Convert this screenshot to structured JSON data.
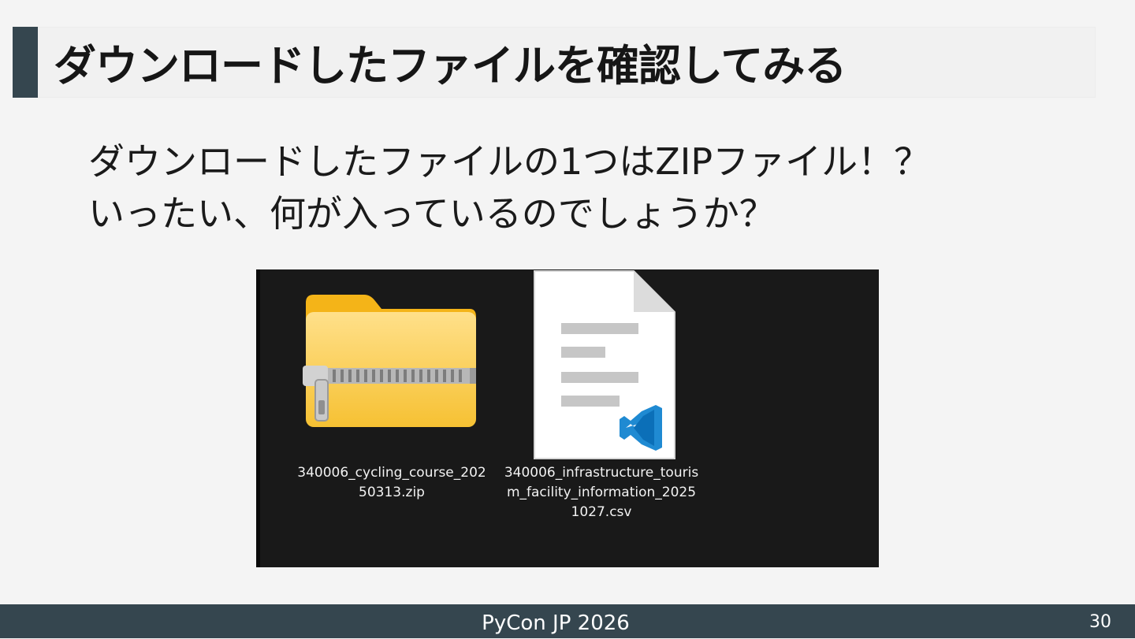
{
  "slide": {
    "title": "ダウンロードしたファイルを確認してみる",
    "body_lines": [
      "ダウンロードしたファイルの1つはZIPファイル！？",
      "いったい、何が入っているのでしょうか？"
    ]
  },
  "explorer": {
    "files": [
      {
        "name": "340006_cycling_course_20250313.zip",
        "icon": "zip-folder-icon"
      },
      {
        "name": "340006_infrastructure_tourism_facility_information_20251027.csv",
        "icon": "vscode-document-icon"
      }
    ]
  },
  "footer": {
    "text": "PyCon JP 2026",
    "page_number": "30"
  },
  "colors": {
    "accent": "#35464f",
    "background": "#f4f4f4",
    "explorer_background": "#191919",
    "vscode_blue": "#1f8ad2"
  }
}
